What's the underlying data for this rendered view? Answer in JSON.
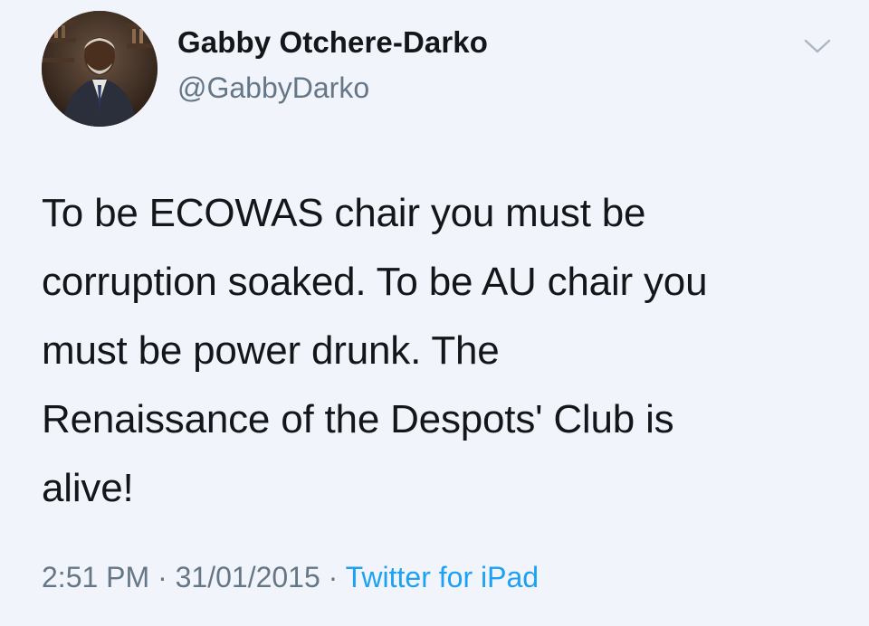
{
  "author": {
    "name": "Gabby Otchere-Darko",
    "handle": "@GabbyDarko",
    "avatar_icon": "profile-photo"
  },
  "tweet": {
    "lines": [
      "To be ECOWAS chair you must be",
      "corruption soaked. To be AU chair you",
      "must be power drunk. The",
      "Renaissance of the Despots' Club is",
      "alive!"
    ]
  },
  "meta": {
    "time": "2:51 PM",
    "separator": " · ",
    "date": "31/01/2015",
    "separator2": " · ",
    "source": "Twitter for iPad"
  },
  "menu": {
    "icon": "chevron-down-icon"
  },
  "colors": {
    "background": "#f1f4fb",
    "text": "#14171a",
    "secondary": "#657786",
    "link": "#1da1f2"
  }
}
